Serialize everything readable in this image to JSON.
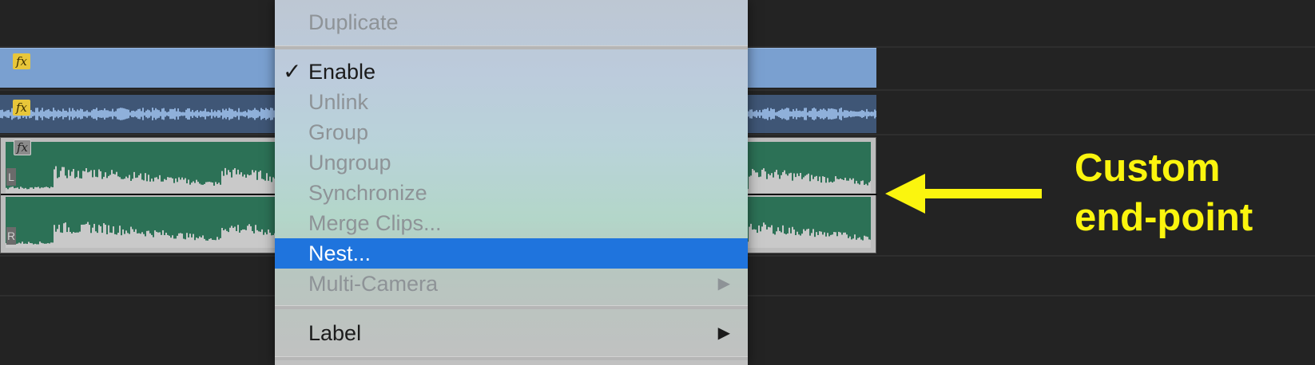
{
  "context_menu": {
    "items": [
      {
        "label": "Duplicate",
        "enabled": false
      },
      {
        "label": "Enable",
        "enabled": true,
        "checked": true
      },
      {
        "label": "Unlink",
        "enabled": false
      },
      {
        "label": "Group",
        "enabled": false
      },
      {
        "label": "Ungroup",
        "enabled": false
      },
      {
        "label": "Synchronize",
        "enabled": false
      },
      {
        "label": "Merge Clips...",
        "enabled": false
      },
      {
        "label": "Nest...",
        "enabled": true,
        "selected": true
      },
      {
        "label": "Multi-Camera",
        "enabled": false,
        "submenu": true
      },
      {
        "label": "Label",
        "enabled": true,
        "submenu": true
      }
    ],
    "check_glyph": "✓",
    "submenu_glyph": "▶",
    "selected_color": "#1f74dd"
  },
  "timeline": {
    "video_clip": {
      "fx_label": "fx",
      "color": "#7aa0d0"
    },
    "audio_clip_top": {
      "fx_label": "fx",
      "color": "#3f5676"
    },
    "audio_clip_stereo": {
      "fx_label": "fx",
      "color": "#2c7156",
      "left_channel_label": "L",
      "right_channel_label": "R"
    }
  },
  "annotation": {
    "text": "Custom\nend-point",
    "color": "#fbf50e",
    "arrow_icon": "left-arrow-icon"
  }
}
